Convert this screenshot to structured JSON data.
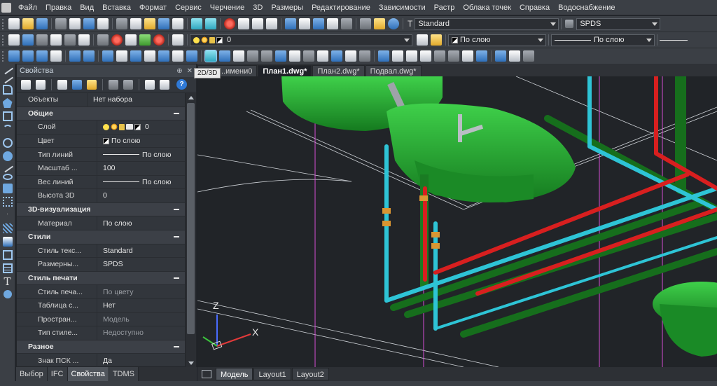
{
  "menu": [
    "Файл",
    "Правка",
    "Вид",
    "Вставка",
    "Формат",
    "Сервис",
    "Черчение",
    "3D",
    "Размеры",
    "Редактирование",
    "Зависимости",
    "Растр",
    "Облака точек",
    "Справка",
    "Водоснабжение"
  ],
  "toolbar": {
    "text_style": "Standard",
    "dim_style": "SPDS",
    "layer": "0",
    "color": "По слою",
    "linetype": "По слою"
  },
  "tooltip": "2D/3D",
  "panel": {
    "title": "Свойства",
    "objects_label": "Объекты",
    "objects_value": "Нет набора",
    "categories": [
      {
        "title": "Общие",
        "rows": [
          {
            "key": "Слой",
            "value": "0"
          },
          {
            "key": "Цвет",
            "value": "По слою"
          },
          {
            "key": "Тип линий",
            "value": "По слою"
          },
          {
            "key": "Масштаб ...",
            "value": "100"
          },
          {
            "key": "Вес линий",
            "value": "По слою"
          },
          {
            "key": "Высота 3D",
            "value": "0"
          }
        ]
      },
      {
        "title": "3D-визуализация",
        "rows": [
          {
            "key": "Материал",
            "value": "По слою"
          }
        ]
      },
      {
        "title": "Стили",
        "rows": [
          {
            "key": "Стиль текс...",
            "value": "Standard"
          },
          {
            "key": "Размерны...",
            "value": "SPDS"
          }
        ]
      },
      {
        "title": "Стиль печати",
        "rows": [
          {
            "key": "Стиль печа...",
            "value": "По цвету"
          },
          {
            "key": "Таблица с...",
            "value": "Нет"
          },
          {
            "key": "Простран...",
            "value": "Модель"
          },
          {
            "key": "Тип стиле...",
            "value": "Недоступно"
          }
        ]
      },
      {
        "title": "Разное",
        "rows": [
          {
            "key": "Знак ПСК ...",
            "value": "Да"
          }
        ]
      }
    ]
  },
  "panel_tabs": [
    "Выбор",
    "IFC",
    "Свойства",
    "TDMS"
  ],
  "doc_tabs": [
    "...имени0",
    "План1.dwg*",
    "План2.dwg*",
    "Подвал.dwg*"
  ],
  "layout_tabs": [
    "Модель",
    "Layout1",
    "Layout2"
  ],
  "ucs": {
    "z": "Z",
    "x": "X"
  },
  "colors": {
    "pipe_cold": "#2ec4d6",
    "pipe_hot": "#d81f1f",
    "pipe_drain": "#1f7a22",
    "fixture": "#22a335"
  }
}
